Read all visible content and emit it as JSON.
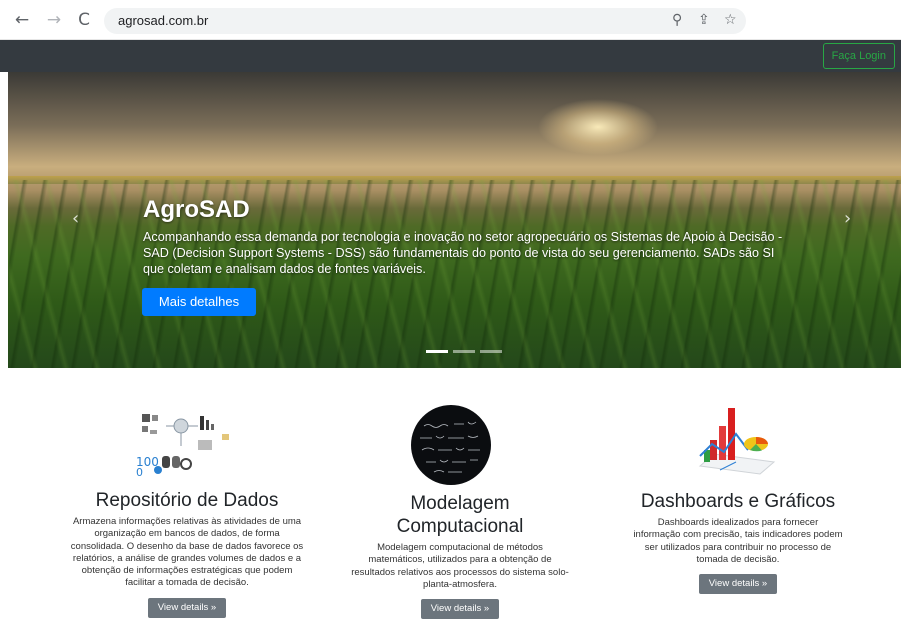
{
  "browser": {
    "url": "agrosad.com.br"
  },
  "navbar": {
    "login_label": "Faça Login"
  },
  "carousel": {
    "title": "AgroSAD",
    "text": "Acompanhando essa demanda por tecnologia e inovação no setor agropecuário os Sistemas de Apoio à Decisão - SAD (Decision Support Systems - DSS) são fundamentais do ponto de vista do seu gerenciamento. SADs são SI que coletam e analisam dados de fontes variáveis.",
    "button_label": "Mais detalhes",
    "prev_icon": "chevron-left-icon",
    "next_icon": "chevron-right-icon",
    "indicator_count": 3
  },
  "features": [
    {
      "title": "Repositório de Dados",
      "text": "Armazena informações relativas às atividades de uma organização em bancos de dados, de forma consolidada. O desenho da base de dados favorece os relatórios, a análise de grandes volumes de dados e a obtenção de informações estratégicas que podem facilitar a tomada de decisão.",
      "button_label": "View details »",
      "icon": "database-diagram-icon"
    },
    {
      "title": "Modelagem Computacional",
      "text": "Modelagem computacional de métodos matemáticos, utilizados para a obtenção de resultados relativos aos processos do sistema solo-planta-atmosfera.",
      "button_label": "View details »",
      "icon": "math-equations-icon"
    },
    {
      "title": "Dashboards e Gráficos",
      "text": "Dashboards idealizados para fornecer informação com precisão, tais indicadores podem ser utilizados para contribuir no processo de tomada de decisão.",
      "button_label": "View details »",
      "icon": "chart-icon"
    }
  ],
  "colors": {
    "primary": "#007bff",
    "success": "#28a745",
    "navbar": "#343a40",
    "secondary": "#6c757d"
  }
}
